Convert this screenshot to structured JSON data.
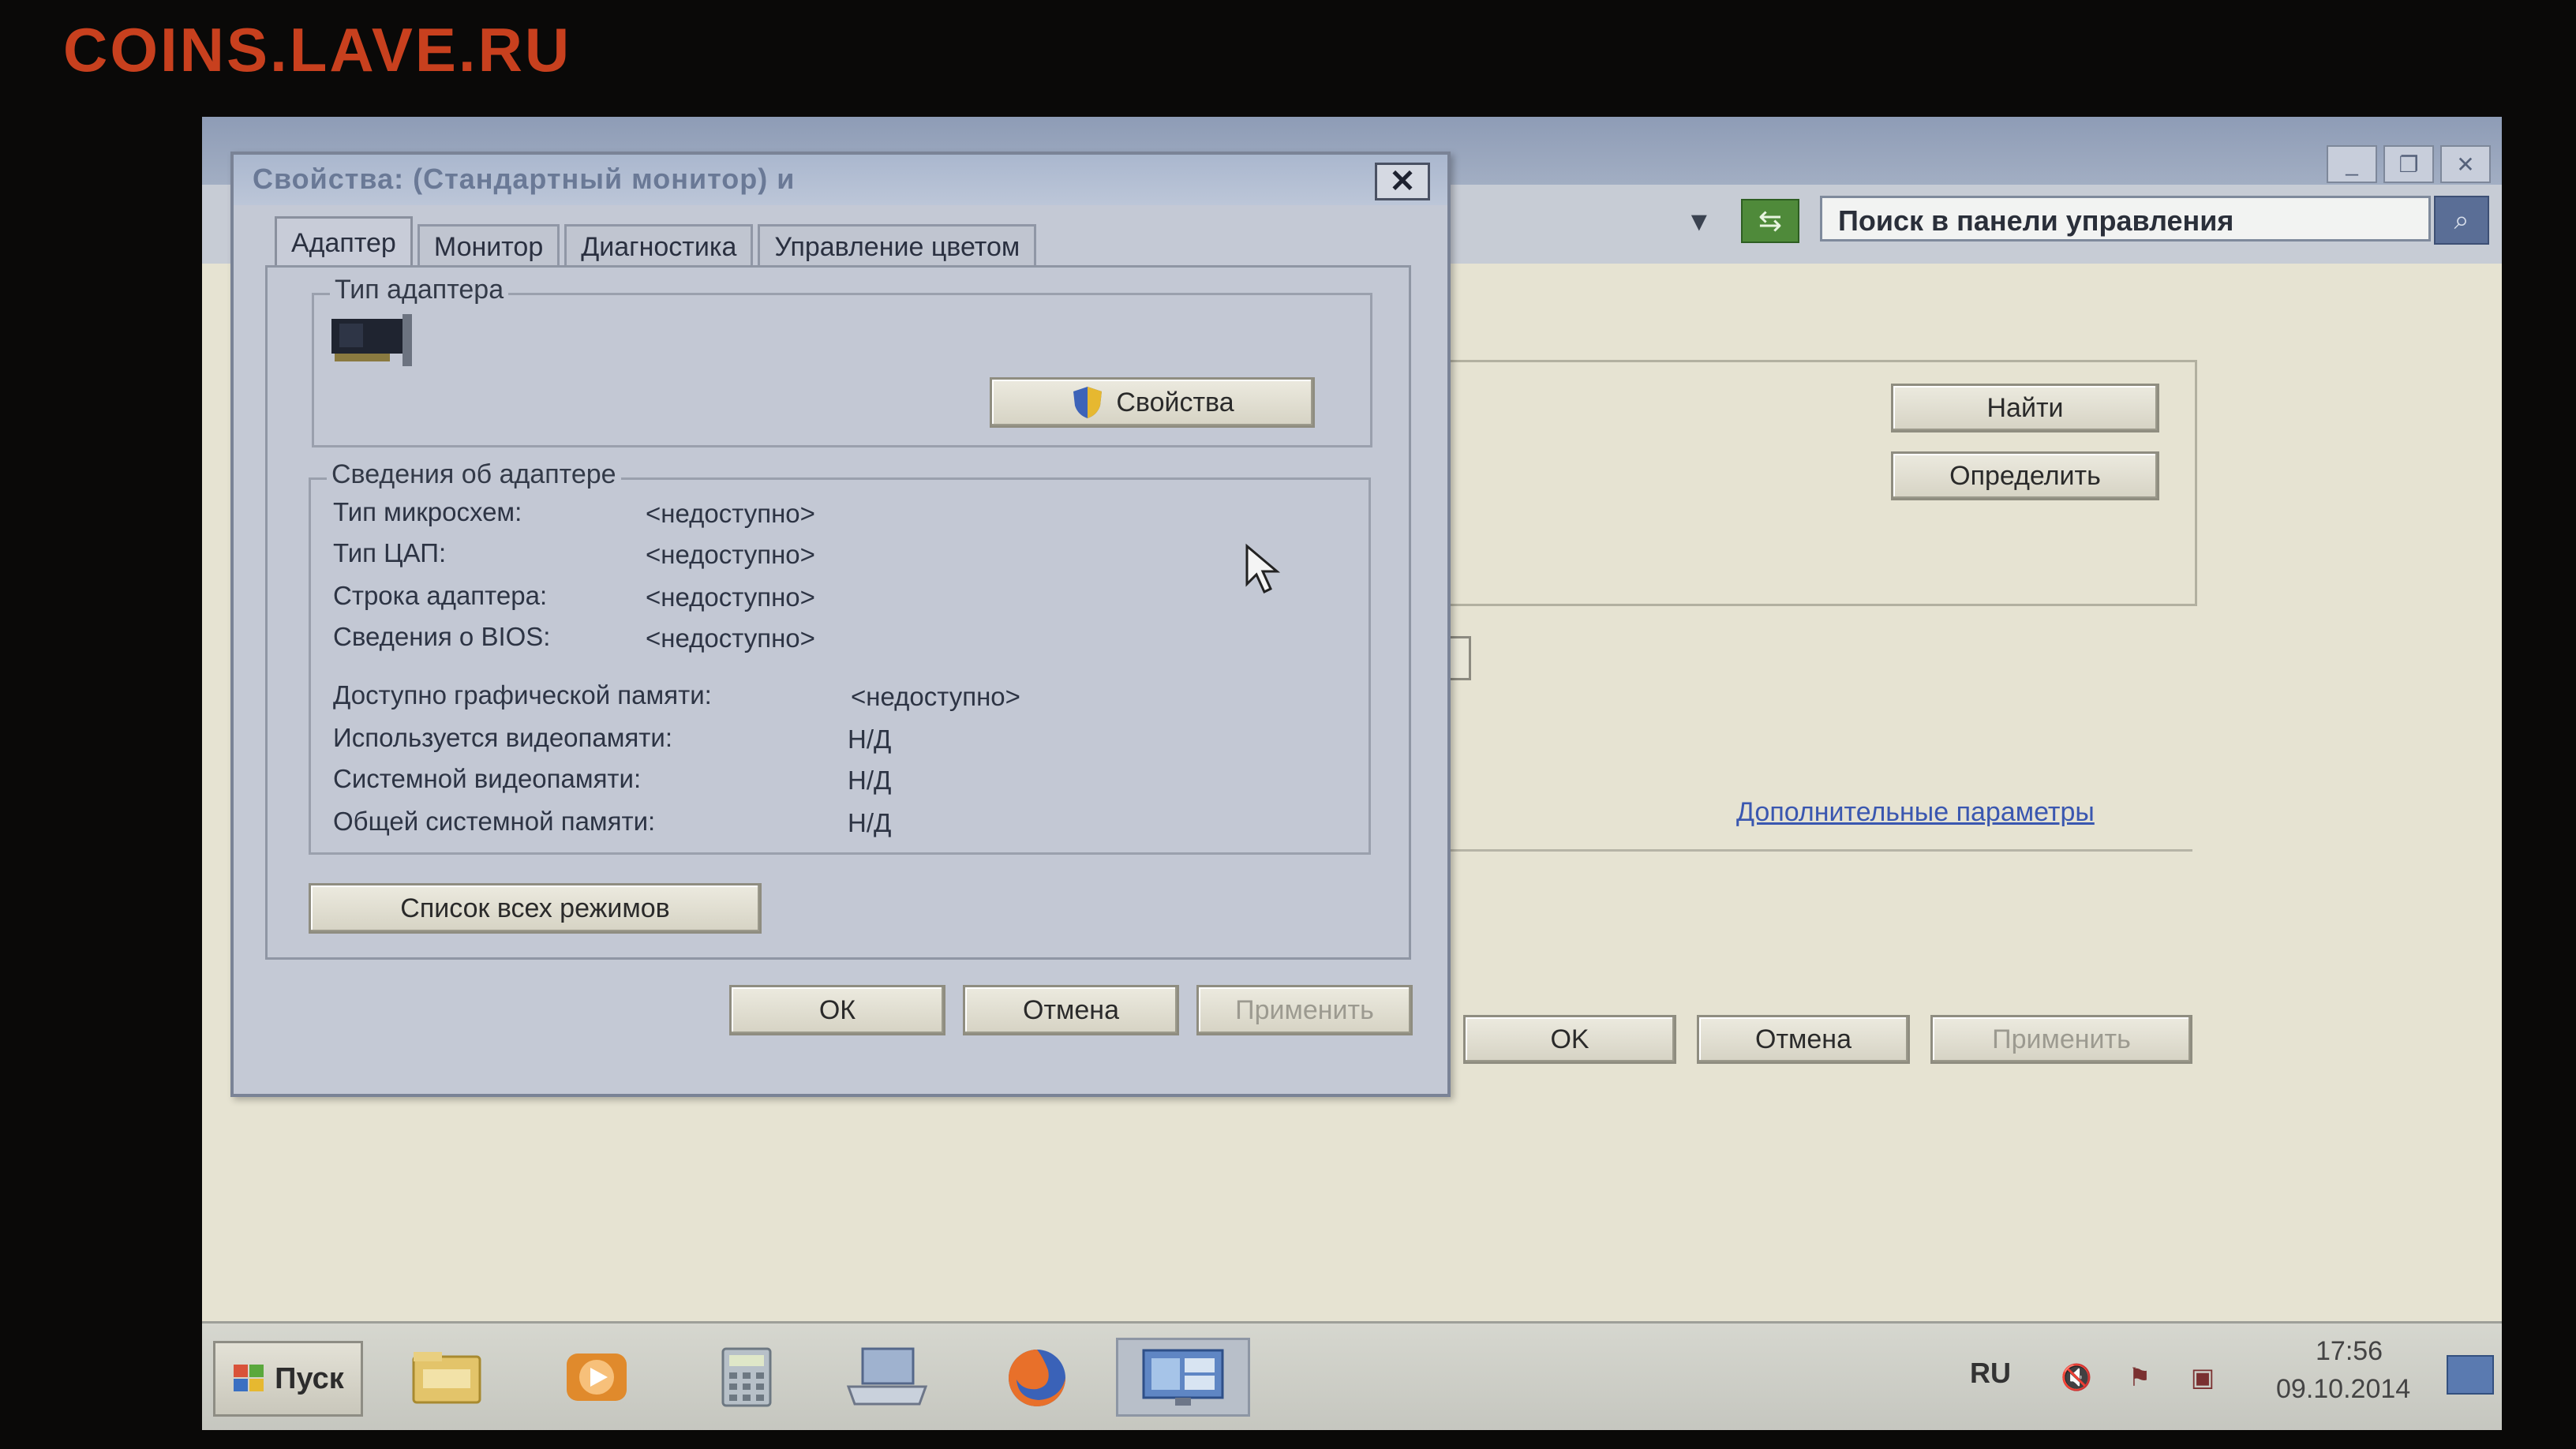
{
  "watermark": "COINS.LAVE.RU",
  "background_window": {
    "search_placeholder": "Поиск в панели управления",
    "find_button": "Найти",
    "detect_button": "Определить",
    "advanced_link": "Дополнительные параметры",
    "ok_button": "OK",
    "cancel_button": "Отмена",
    "apply_button": "Применить"
  },
  "dialog": {
    "title": "Свойства: (Стандартный монитор) и",
    "tabs": [
      {
        "label": "Адаптер",
        "active": true
      },
      {
        "label": "Монитор",
        "active": false
      },
      {
        "label": "Диагностика",
        "active": false
      },
      {
        "label": "Управление цветом",
        "active": false
      }
    ],
    "adapter_type_group": "Тип адаптера",
    "properties_button": "Свойства",
    "adapter_info_group": "Сведения об адаптере",
    "info": [
      {
        "label": "Тип микросхем:",
        "value": "<недоступно>"
      },
      {
        "label": "Тип ЦАП:",
        "value": "<недоступно>"
      },
      {
        "label": "Строка адаптера:",
        "value": "<недоступно>"
      },
      {
        "label": "Сведения о BIOS:",
        "value": "<недоступно>"
      }
    ],
    "memory": [
      {
        "label": "Доступно графической памяти:",
        "value": "<недоступно>"
      },
      {
        "label": "Используется видеопамяти:",
        "value": "Н/Д"
      },
      {
        "label": "Системной видеопамяти:",
        "value": "Н/Д"
      },
      {
        "label": "Общей системной памяти:",
        "value": "Н/Д"
      }
    ],
    "list_modes_button": "Список всех режимов",
    "ok_button": "ОК",
    "cancel_button": "Отмена",
    "apply_button": "Применить"
  },
  "taskbar": {
    "start_label": "Пуск",
    "apps": [
      "explorer-icon",
      "media-player-icon",
      "calculator-icon",
      "keyboard-icon",
      "firefox-icon",
      "display-settings-icon"
    ],
    "language": "RU",
    "time": "17:56",
    "date": "09.10.2014"
  },
  "colors": {
    "watermark": "#c8401e",
    "titlebar": "#aab7ce",
    "search_button": "#5a6e96"
  }
}
